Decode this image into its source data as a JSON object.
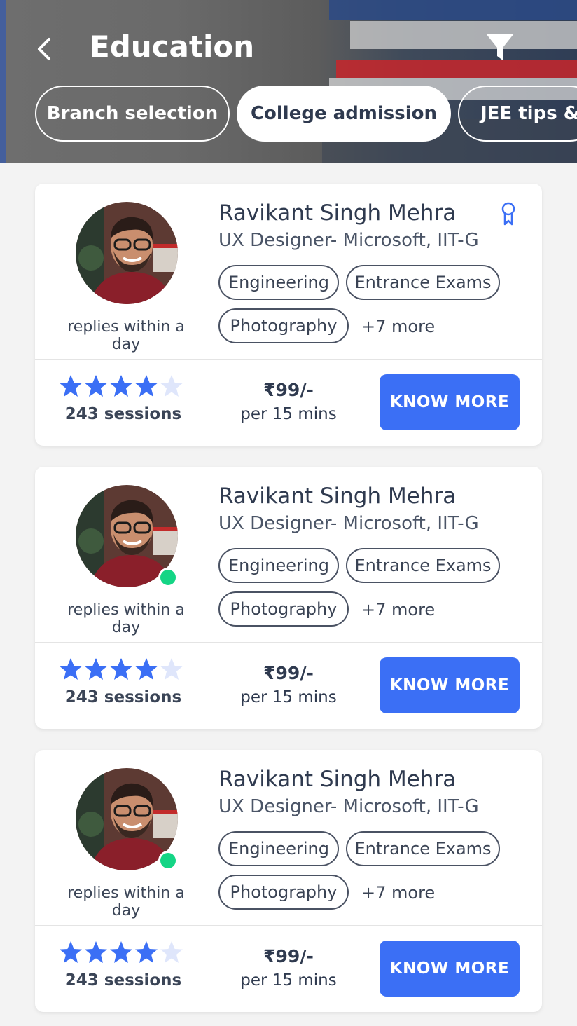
{
  "header": {
    "title": "Education",
    "chips": [
      "Branch selection",
      "College admission",
      "JEE tips & tricks"
    ],
    "active_chip": "College admission"
  },
  "icons": {
    "back": "chevron-left-icon",
    "filter": "filter-icon",
    "badge": "award-ribbon-icon",
    "star": "star-icon"
  },
  "colors": {
    "accent": "#3b6ff5",
    "star_filled": "#3b6ff5",
    "star_empty": "#dfe6fb",
    "online": "#14d585"
  },
  "mentors": [
    {
      "name": "Ravikant Singh Mehra",
      "role": "UX Designer- Microsoft, IIT-G",
      "tags": [
        "Engineering",
        "Entrance Exams",
        "Photography"
      ],
      "more": "+7 more",
      "replies": "replies within a day",
      "rating": 4,
      "rating_max": 5,
      "sessions": "243 sessions",
      "price": "₹99/-",
      "per": "per 15 mins",
      "cta": "KNOW MORE",
      "badge": true,
      "online": false
    },
    {
      "name": "Ravikant Singh Mehra",
      "role": "UX Designer- Microsoft, IIT-G",
      "tags": [
        "Engineering",
        "Entrance Exams",
        "Photography"
      ],
      "more": "+7 more",
      "replies": "replies within a day",
      "rating": 4,
      "rating_max": 5,
      "sessions": "243 sessions",
      "price": "₹99/-",
      "per": "per 15 mins",
      "cta": "KNOW MORE",
      "badge": false,
      "online": true
    },
    {
      "name": "Ravikant Singh Mehra",
      "role": "UX Designer- Microsoft, IIT-G",
      "tags": [
        "Engineering",
        "Entrance Exams",
        "Photography"
      ],
      "more": "+7 more",
      "replies": "replies within a day",
      "rating": 4,
      "rating_max": 5,
      "sessions": "243 sessions",
      "price": "₹99/-",
      "per": "per 15 mins",
      "cta": "KNOW MORE",
      "badge": false,
      "online": true
    }
  ]
}
